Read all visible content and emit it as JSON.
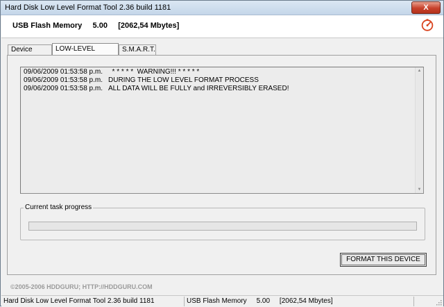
{
  "window": {
    "title": "Hard Disk Low Level Format Tool 2.36 build 1181",
    "close_label": "X"
  },
  "header": {
    "device_name": "USB Flash Memory",
    "device_version": "5.00",
    "device_size": "[2062,54 Mbytes]",
    "logo_icon": "hddguru-logo-icon"
  },
  "tabs": [
    {
      "label": "Device details",
      "active": false
    },
    {
      "label": "LOW-LEVEL FORMAT",
      "active": true
    },
    {
      "label": "S.M.A.R.T.",
      "active": false
    }
  ],
  "log": {
    "lines": [
      {
        "timestamp": "09/06/2009 01:53:58 p.m.",
        "message": "  * * * * *  WARNING!!! * * * * *"
      },
      {
        "timestamp": "09/06/2009 01:53:58 p.m.",
        "message": "DURING THE LOW LEVEL FORMAT PROCESS"
      },
      {
        "timestamp": "09/06/2009 01:53:58 p.m.",
        "message": "ALL DATA WILL BE FULLY and IRREVERSIBLY ERASED!"
      }
    ]
  },
  "progress": {
    "label": "Current task progress",
    "value": 0
  },
  "format_button_label": "FORMAT THIS DEVICE",
  "copyright": "©2005-2006 HDDGURU;  HTTP://HDDGURU.COM",
  "statusbar": {
    "app": "Hard Disk Low Level Format Tool 2.36 build 1181",
    "device": "USB Flash Memory     5.00     [2062,54 Mbytes]",
    "extra": ""
  }
}
